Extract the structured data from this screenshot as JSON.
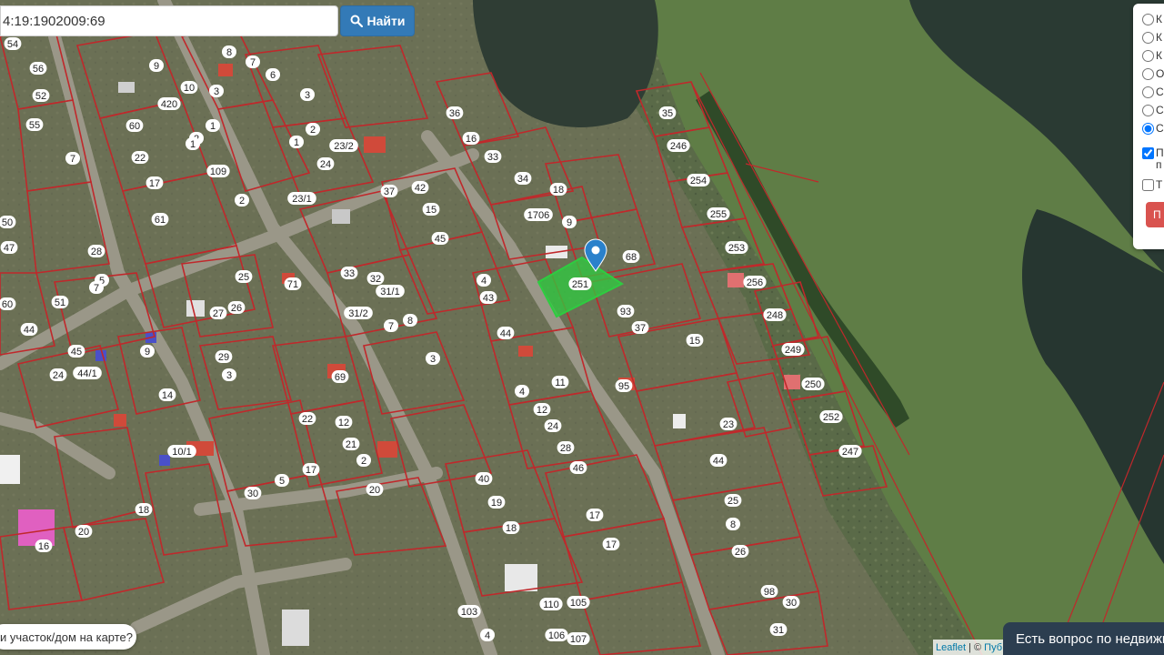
{
  "search": {
    "value": "4:19:1902009:69",
    "button_label": "Найти",
    "button_icon": "search-icon"
  },
  "layers_panel": {
    "radio_labels": [
      "К",
      "К",
      "К",
      "О",
      "С",
      "С",
      "С"
    ],
    "selected_radio_index": 6,
    "checkbox_labels": [
      "П",
      "Т"
    ],
    "checkbox_subtext": [
      "п"
    ],
    "checkbox_checked": [
      true,
      false
    ],
    "button_label": "П"
  },
  "map": {
    "plot_labels": [
      "54",
      "56",
      "8",
      "7",
      "6",
      "3",
      "9",
      "10",
      "420",
      "52",
      "55",
      "60",
      "1",
      "2",
      "1",
      "22",
      "17",
      "61",
      "7",
      "50",
      "47",
      "28",
      "5",
      "7",
      "25",
      "71",
      "60",
      "51",
      "44",
      "45",
      "9",
      "24",
      "44/1",
      "14",
      "29",
      "27",
      "26",
      "3",
      "33",
      "32",
      "31/1",
      "31/2",
      "7",
      "8",
      "3",
      "12",
      "22",
      "69",
      "21",
      "2",
      "20",
      "17",
      "5",
      "30",
      "10/1",
      "18",
      "20",
      "16",
      "36",
      "16",
      "33",
      "34",
      "18",
      "9",
      "1706",
      "37",
      "42",
      "15",
      "45",
      "23/1",
      "2",
      "1",
      "24",
      "23/2",
      "109",
      "2",
      "3",
      "4",
      "43",
      "44",
      "4",
      "12",
      "24",
      "28",
      "46",
      "40",
      "19",
      "18",
      "17",
      "17",
      "110",
      "105",
      "106",
      "107",
      "103",
      "4",
      "11",
      "95",
      "68",
      "93",
      "37",
      "15",
      "23",
      "44",
      "25",
      "8",
      "26",
      "98",
      "30",
      "31",
      "35",
      "246",
      "254",
      "255",
      "253",
      "256",
      "248",
      "249",
      "250",
      "252",
      "247",
      "251",
      "20"
    ],
    "selected_plot_label": "20",
    "colors": {
      "boundary": "#c0282b",
      "selected_fill": "#2ecc40",
      "marker": "#2a81cb"
    }
  },
  "help_pill_text": "и участок/дом на карте?",
  "attribution": {
    "leaflet": "Leaflet",
    "separator": " | © ",
    "source": "Пуб"
  },
  "chat_tab_text": "Есть вопрос по недвижи"
}
